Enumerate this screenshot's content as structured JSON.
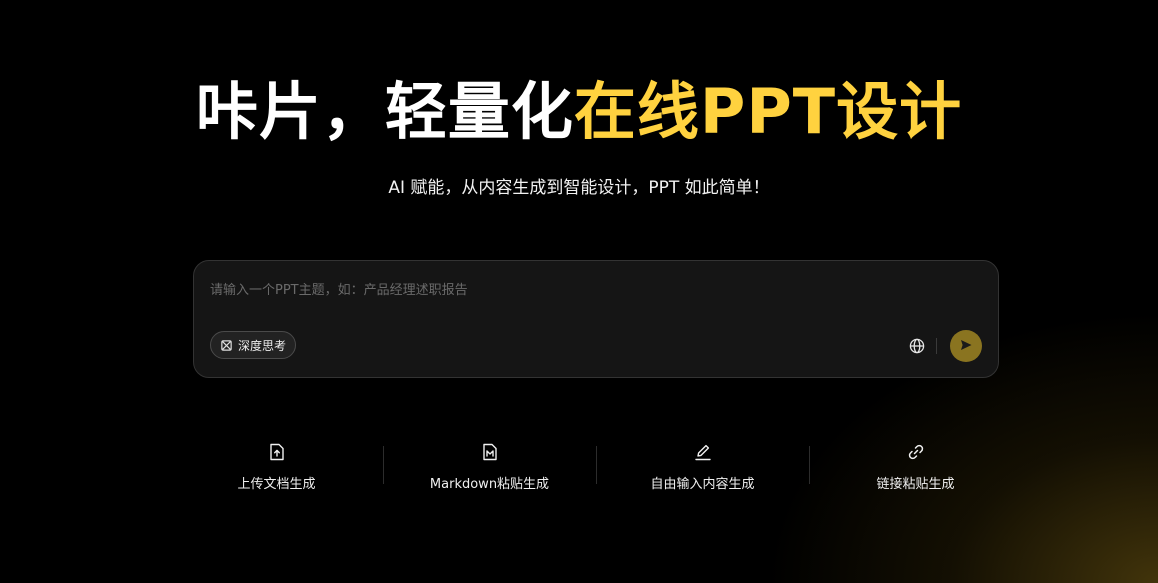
{
  "hero": {
    "title_main": "咔片，轻量化",
    "title_highlight": "在线PPT设计",
    "subtitle": "AI 赋能，从内容生成到智能设计，PPT 如此简单！"
  },
  "prompt": {
    "placeholder": "请输入一个PPT主题，如：产品经理述职报告",
    "value": "",
    "deep_think_label": "深度思考",
    "deep_think_icon": "atom-icon",
    "web_search_icon": "globe-icon",
    "send_icon": "send-icon"
  },
  "actions": [
    {
      "label": "上传文档生成",
      "icon": "upload-file-icon"
    },
    {
      "label": "Markdown粘贴生成",
      "icon": "markdown-file-icon"
    },
    {
      "label": "自由输入内容生成",
      "icon": "pen-icon"
    },
    {
      "label": "链接粘贴生成",
      "icon": "link-icon"
    }
  ],
  "colors": {
    "background": "#000000",
    "accent": "#ffd23f",
    "send_button": "#8a7420"
  }
}
